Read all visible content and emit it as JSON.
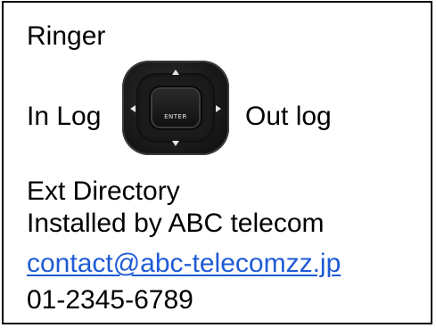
{
  "menu": {
    "ringer": "Ringer",
    "in_log": "In Log",
    "out_log": "Out log",
    "ext_directory": "Ext Directory"
  },
  "dpad": {
    "center_label": "ENTER",
    "icon": "dpad-navigation-icon"
  },
  "info": {
    "installed_by": "Installed by ABC telecom",
    "email": "contact@abc-telecomzz.jp",
    "phone": "01-2345-6789"
  },
  "colors": {
    "text": "#000000",
    "link": "#1f5bd6",
    "border": "#000000",
    "background": "#ffffff"
  }
}
